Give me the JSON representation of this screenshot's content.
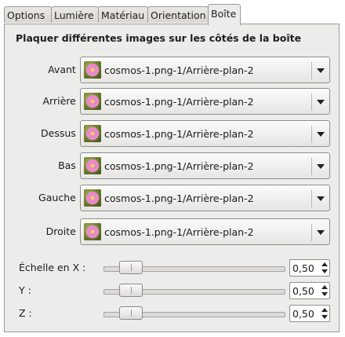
{
  "tabs": [
    {
      "label": "Options"
    },
    {
      "label": "Lumière"
    },
    {
      "label": "Matériau"
    },
    {
      "label": "Orientation"
    },
    {
      "label": "Boîte"
    }
  ],
  "active_tab": "Boîte",
  "section": {
    "title": "Plaquer différentes images sur les côtés de la boîte"
  },
  "faces": [
    {
      "label": "Avant :",
      "value": "cosmos-1.png-1/Arrière-plan-2",
      "icon": "image-thumbnail-icon"
    },
    {
      "label": "Arrière :",
      "value": "cosmos-1.png-1/Arrière-plan-2",
      "icon": "image-thumbnail-icon"
    },
    {
      "label": "Dessus :",
      "value": "cosmos-1.png-1/Arrière-plan-2",
      "icon": "image-thumbnail-icon"
    },
    {
      "label": "Bas :",
      "value": "cosmos-1.png-1/Arrière-plan-2",
      "icon": "image-thumbnail-icon"
    },
    {
      "label": "Gauche :",
      "value": "cosmos-1.png-1/Arrière-plan-2",
      "icon": "image-thumbnail-icon"
    },
    {
      "label": "Droite :",
      "value": "cosmos-1.png-1/Arrière-plan-2",
      "icon": "image-thumbnail-icon"
    }
  ],
  "scales": [
    {
      "label": "Échelle en X :",
      "value": "0,50",
      "level": 0.1
    },
    {
      "label": "Y :",
      "value": "0,50",
      "level": 0.1
    },
    {
      "label": "Z :",
      "value": "0,50",
      "level": 0.1
    }
  ],
  "colors": {
    "panel": "#ececea",
    "border": "#9a9a96",
    "thumbnail_flower": "#e88ac8"
  }
}
